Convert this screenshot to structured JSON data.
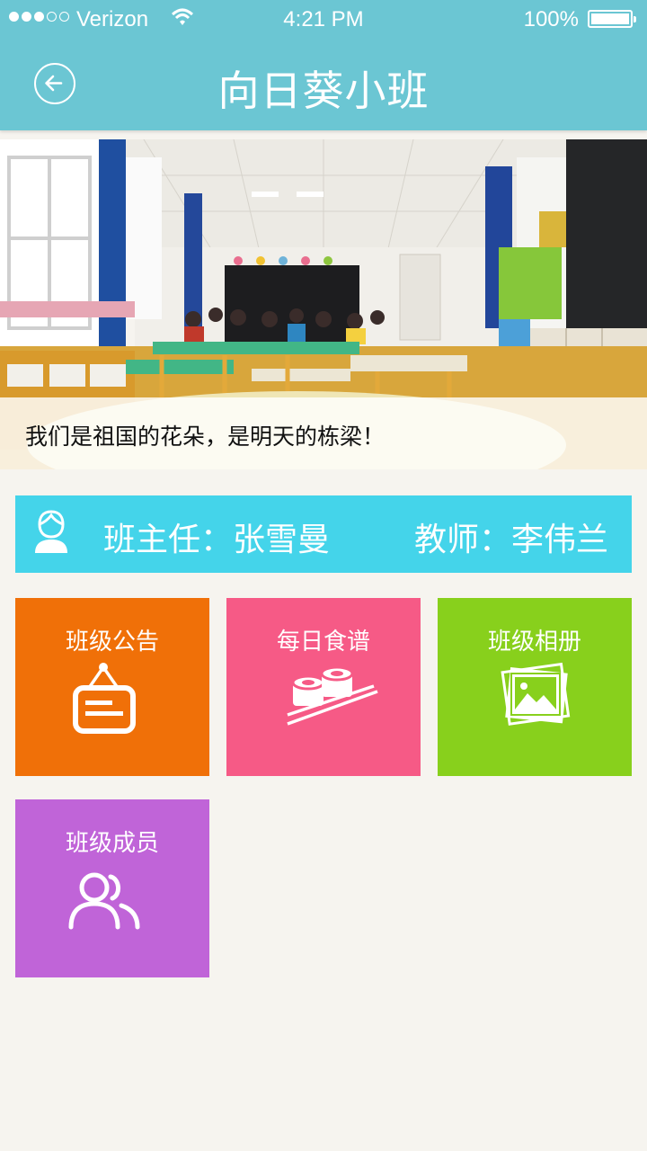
{
  "status_bar": {
    "carrier": "Verizon",
    "time": "4:21 PM",
    "battery": "100%",
    "signal_bars_filled": 3,
    "signal_bars_total": 5
  },
  "nav": {
    "title": "向日葵小班",
    "back_icon": "back-arrow-icon"
  },
  "banner": {
    "caption": "我们是祖国的花朵，是明天的栋梁！"
  },
  "teachers": {
    "head_teacher": "班主任：张雪曼",
    "teacher": "教师：李伟兰"
  },
  "tiles": [
    {
      "label": "班级公告",
      "icon": "notice-board-icon",
      "color": "#f07008"
    },
    {
      "label": "每日食谱",
      "icon": "sushi-chopsticks-icon",
      "color": "#f65a86"
    },
    {
      "label": "班级相册",
      "icon": "photo-album-icon",
      "color": "#88d01c"
    },
    {
      "label": "班级成员",
      "icon": "members-icon",
      "color": "#c064d8"
    }
  ],
  "colors": {
    "header": "#6bc6d3",
    "teacher_bar": "#44d4ea",
    "background": "#f6f4ef"
  }
}
